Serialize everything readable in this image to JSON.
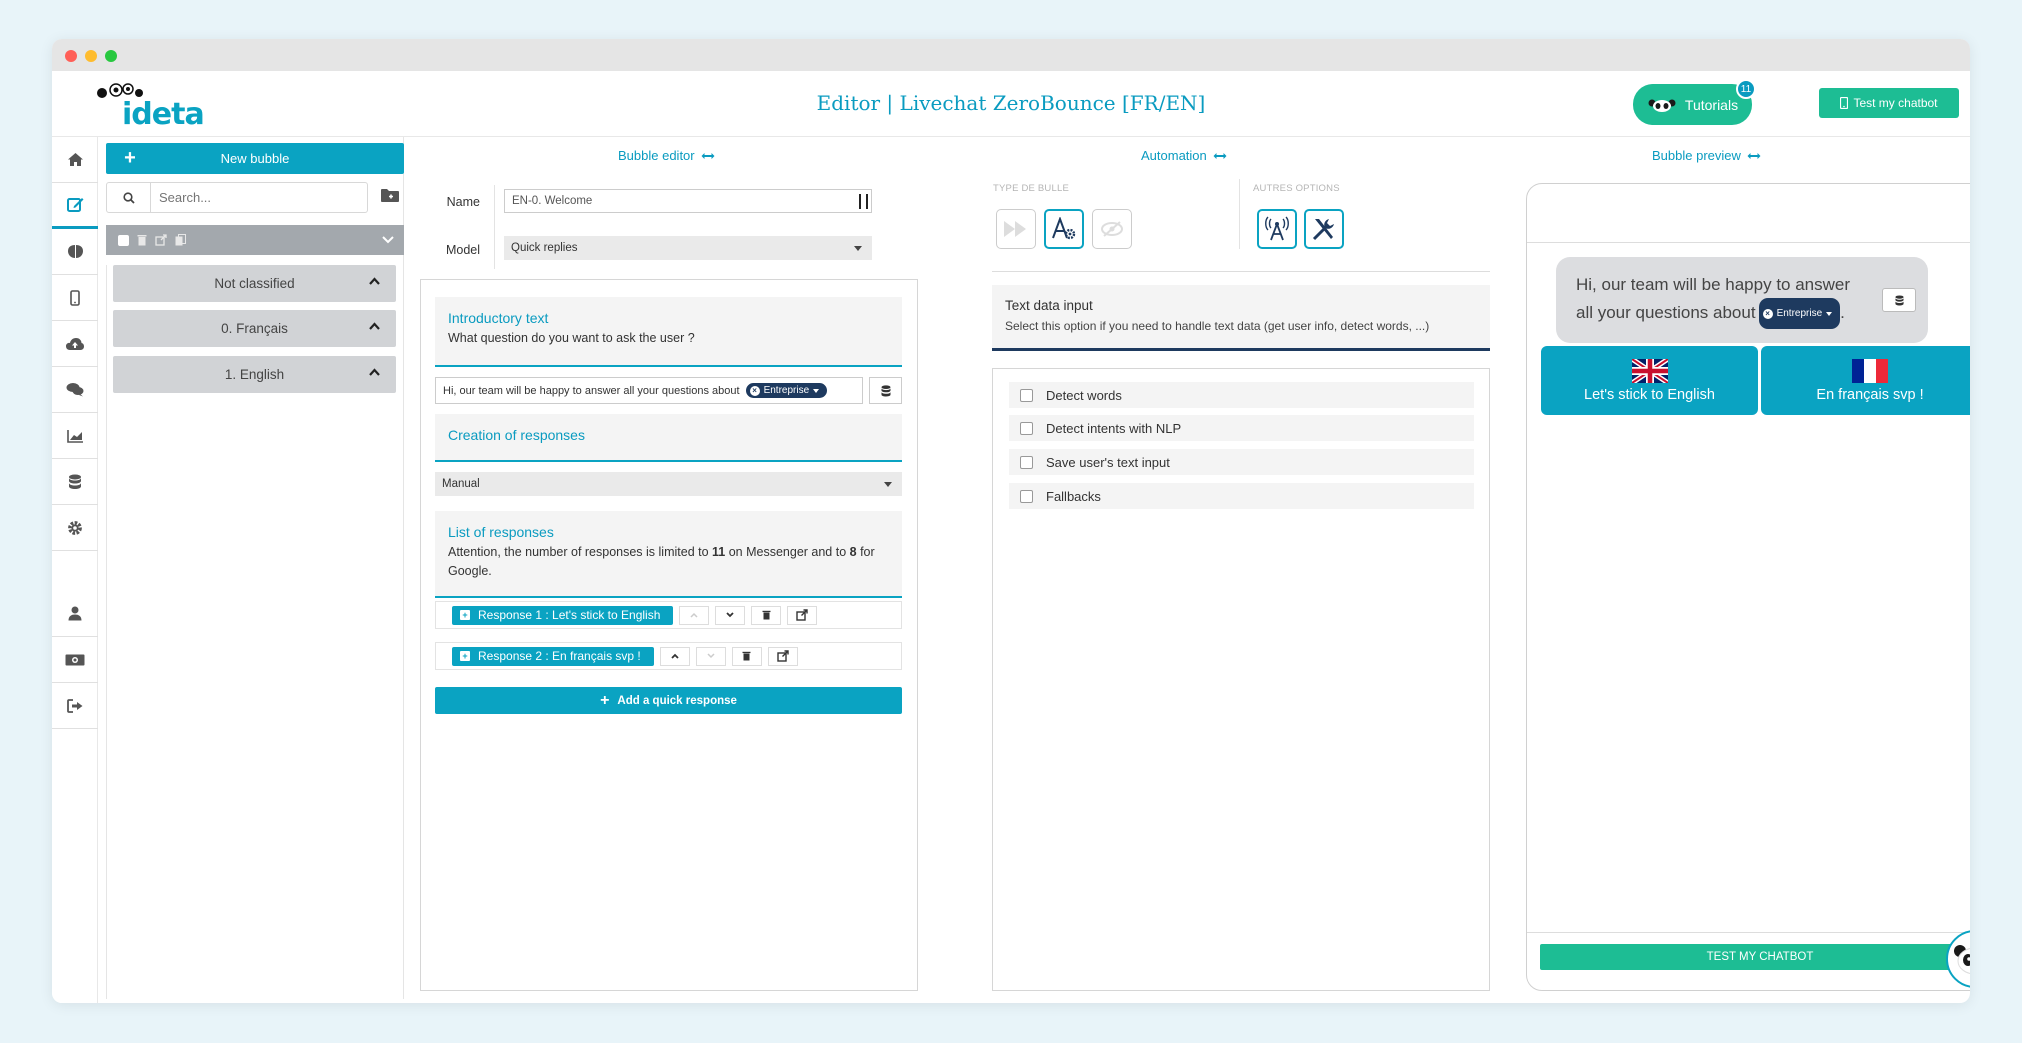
{
  "app": {
    "logo_text": "ideta",
    "page_title": "Editor | Livechat ZeroBounce [FR/EN]",
    "tutorials_label": "Tutorials",
    "tutorials_badge": "11",
    "test_chatbot_label": "Test my chatbot"
  },
  "nav": {
    "items": [
      "home-icon",
      "edit-icon",
      "brain-icon",
      "mobile-icon",
      "cloud-upload-icon",
      "comments-icon",
      "chart-icon",
      "database-icon",
      "cog-icon",
      "user-icon",
      "money-icon",
      "sign-out-icon"
    ]
  },
  "sidebar": {
    "new_bubble_label": "New bubble",
    "search_placeholder": "Search...",
    "groups": [
      {
        "label": "Not classified"
      },
      {
        "label": "0. Français"
      },
      {
        "label": "1. English"
      }
    ]
  },
  "editor": {
    "bubble_editor_label": "Bubble editor",
    "automation_label": "Automation",
    "bubble_preview_label": "Bubble preview",
    "name_label": "Name",
    "name_value": "EN-0. Welcome",
    "model_label": "Model",
    "model_value": "Quick replies",
    "intro": {
      "title": "Introductory text",
      "subtitle": "What question do you want to ask the user ?",
      "input_text": "Hi, our team will be happy to answer all your questions about",
      "tag": "Entreprise"
    },
    "creation": {
      "title": "Creation of responses",
      "select_value": "Manual"
    },
    "list": {
      "title": "List of responses",
      "note_pre": "Attention, the number of responses is limited to ",
      "messenger_limit": "11",
      "note_mid": " on Messenger and to ",
      "google_limit": "8",
      "note_post": " for Google."
    },
    "responses": [
      {
        "label": "Response 1 : Let's stick to English"
      },
      {
        "label": "Response 2 : En français svp !"
      }
    ],
    "add_quick_response_label": "Add a quick response"
  },
  "automation": {
    "type_label": "TYPE DE BULLE",
    "other_label": "AUTRES OPTIONS",
    "text_input": {
      "title": "Text data input",
      "subtitle": "Select this option if you need to handle text data (get user info, detect words, ...)"
    },
    "options": [
      {
        "label": "Detect words"
      },
      {
        "label": "Detect intents with NLP"
      },
      {
        "label": "Save user's text input"
      },
      {
        "label": "Fallbacks"
      }
    ]
  },
  "preview": {
    "message_line1": "Hi, our team will be happy to answer",
    "message_line2": "all your questions about",
    "tag": "Entreprise",
    "quick_replies": [
      {
        "label": "Let's stick to English",
        "flag": "uk-flag-icon"
      },
      {
        "label": "En français svp !",
        "flag": "fr-flag-icon"
      }
    ],
    "test_button_label": "TEST MY CHATBOT"
  },
  "colors": {
    "accent": "#0aa3c2",
    "green": "#1dbd94",
    "navy": "#1e3a5f"
  }
}
